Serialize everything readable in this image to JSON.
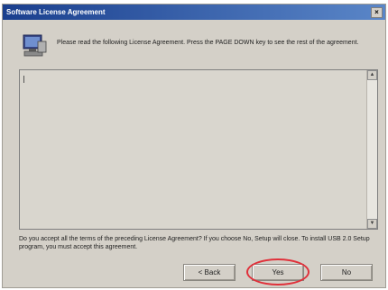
{
  "window": {
    "title": "Software License Agreement",
    "close_glyph": "×"
  },
  "intro_text": "Please read the following License Agreement. Press the PAGE DOWN key to see the rest of the agreement.",
  "license_text": "",
  "question_text": "Do you accept all the terms of the preceding License Agreement? If you choose No, Setup will close. To install USB 2.0 Setup program, you must accept this agreement.",
  "buttons": {
    "back": "< Back",
    "yes": "Yes",
    "no": "No"
  },
  "scroll": {
    "up_glyph": "▲",
    "down_glyph": "▼"
  },
  "icons": {
    "header": "setup-computer-icon"
  },
  "colors": {
    "titlebar": "#1a3f8e",
    "dialog_bg": "#d4d0c8",
    "highlight": "#e0303a"
  }
}
